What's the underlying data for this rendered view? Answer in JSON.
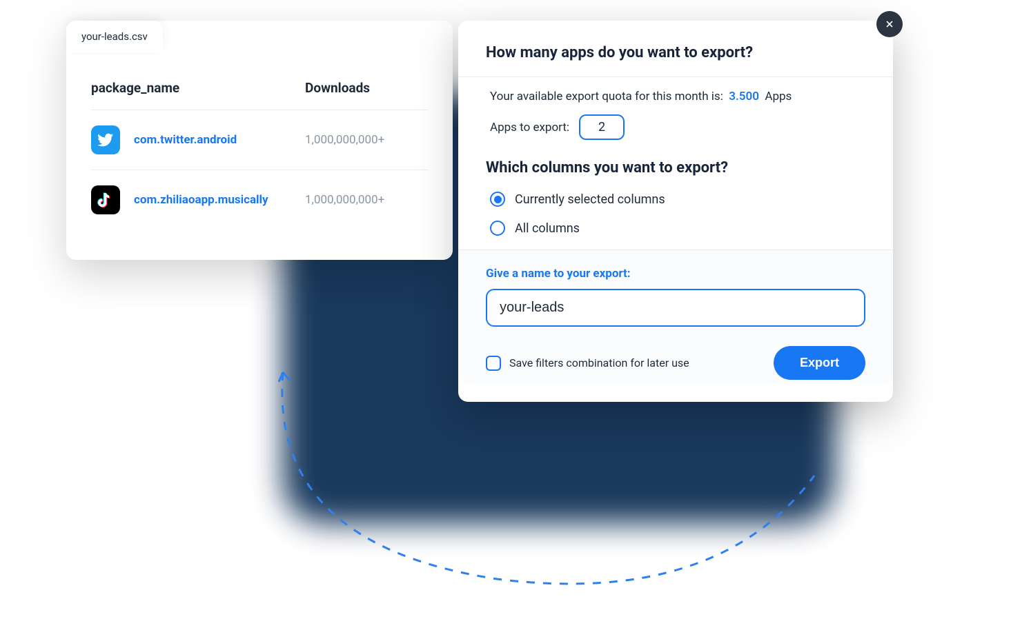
{
  "csv": {
    "tab": "your-leads.csv",
    "columns": {
      "pkg": "package_name",
      "downloads": "Downloads"
    },
    "rows": [
      {
        "icon": "twitter",
        "pkg": "com.twitter.android",
        "downloads": "1,000,000,000+"
      },
      {
        "icon": "tiktok",
        "pkg": "com.zhiliaoapp.musically",
        "downloads": "1,000,000,000+"
      }
    ]
  },
  "modal": {
    "title1": "How many apps do you want to export?",
    "quota_text_a": "Your available export quota for this month is:",
    "quota_value": "3.500",
    "quota_unit": "Apps",
    "apps_label": "Apps to export:",
    "apps_value": "2",
    "title2": "Which columns you want to export?",
    "radio": [
      {
        "label": "Currently selected columns",
        "checked": true
      },
      {
        "label": "All columns",
        "checked": false
      }
    ],
    "name_label": "Give a name to your export:",
    "name_value": "your-leads",
    "save_filters": "Save filters combination for later use",
    "export_btn": "Export"
  }
}
